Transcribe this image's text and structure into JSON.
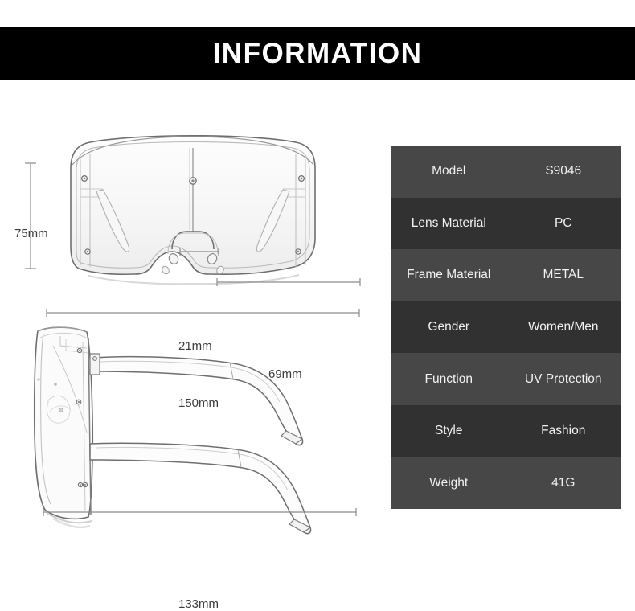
{
  "header": {
    "title": "INFORMATION"
  },
  "diagram": {
    "front_view_name": "sunglasses-front-view",
    "side_view_name": "sunglasses-side-view",
    "dimensions": {
      "height": "75mm",
      "bridge": "21mm",
      "lens_width": "69mm",
      "total_width": "150mm",
      "temple_length": "133mm"
    },
    "line_color": "#6b6b6b"
  },
  "spec_table": {
    "rows": [
      {
        "key": "Model",
        "value": "S9046"
      },
      {
        "key": "Lens Material",
        "value": "PC"
      },
      {
        "key": "Frame Material",
        "value": "METAL"
      },
      {
        "key": "Gender",
        "value": "Women/Men"
      },
      {
        "key": "Function",
        "value": "UV Protection"
      },
      {
        "key": "Style",
        "value": "Fashion"
      },
      {
        "key": "Weight",
        "value": "41G"
      }
    ],
    "row_color_odd": "#474747",
    "row_color_even": "#313131",
    "text_color": "#f2f2f2"
  }
}
